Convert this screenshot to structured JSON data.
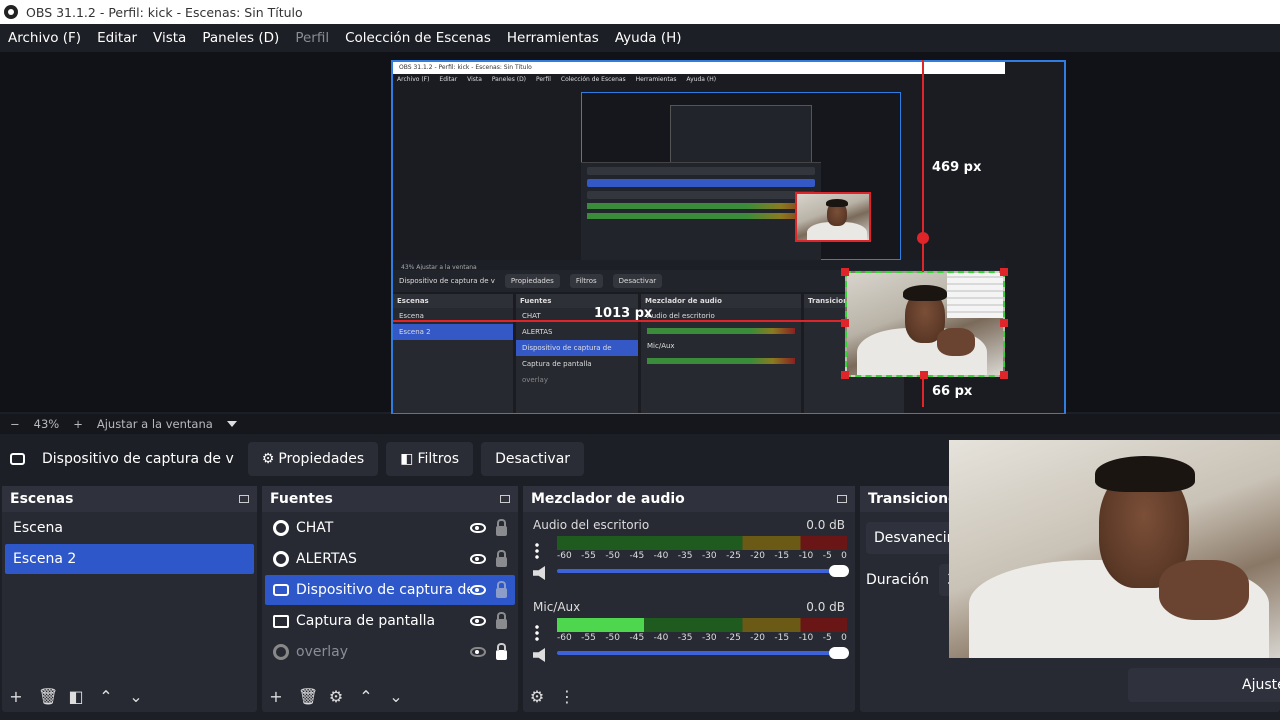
{
  "window": {
    "title": "OBS 31.1.2 - Perfil: kick - Escenas: Sin Título"
  },
  "menu": [
    {
      "label": "Archivo (F)",
      "disabled": false
    },
    {
      "label": "Editar",
      "disabled": false
    },
    {
      "label": "Vista",
      "disabled": false
    },
    {
      "label": "Paneles (D)",
      "disabled": false
    },
    {
      "label": "Perfil",
      "disabled": true
    },
    {
      "label": "Colección de Escenas",
      "disabled": false
    },
    {
      "label": "Herramientas",
      "disabled": false
    },
    {
      "label": "Ayuda (H)",
      "disabled": false
    }
  ],
  "preview": {
    "mini_title": "OBS 31.1.2 - Perfil: kick - Escenas: Sin Título",
    "mini_menu": [
      "Archivo (F)",
      "Editar",
      "Vista",
      "Paneles (D)",
      "Perfil",
      "Colección de Escenas",
      "Herramientas",
      "Ayuda (H)"
    ],
    "mini_zoom": "43%   Ajustar a la ventana",
    "mini_source": "Dispositivo de captura de v",
    "mini_props": "Propiedades",
    "mini_filters": "Filtros",
    "mini_deactivate": "Desactivar",
    "mini_scenes_head": "Escenas",
    "mini_scenes": [
      "Escena",
      "Escena 2"
    ],
    "mini_sources_head": "Fuentes",
    "mini_sources": [
      "CHAT",
      "ALERTAS",
      "Dispositivo de captura de",
      "Captura de pantalla",
      "overlay"
    ],
    "mini_mixer_head": "Mezclador de audio",
    "mini_mixer_ch1": "Audio del escritorio",
    "mini_mixer_ch2": "Mic/Aux",
    "mini_trans_head": "Transicione",
    "measure_top": "469 px",
    "measure_left": "1013 px",
    "measure_bottom": "66 px"
  },
  "zoom": {
    "minus": "−",
    "value": "43%",
    "plus": "+",
    "fit": "Ajustar a la ventana"
  },
  "source_toolbar": {
    "source_name": "Dispositivo de captura de v",
    "properties": "Propiedades",
    "filters": "Filtros",
    "deactivate": "Desactivar"
  },
  "scenes": {
    "title": "Escenas",
    "items": [
      {
        "label": "Escena",
        "selected": false
      },
      {
        "label": "Escena 2",
        "selected": true
      }
    ]
  },
  "sources": {
    "title": "Fuentes",
    "items": [
      {
        "label": "CHAT",
        "selected": false,
        "hidden": false
      },
      {
        "label": "ALERTAS",
        "selected": false,
        "hidden": false
      },
      {
        "label": "Dispositivo de captura de v",
        "selected": true,
        "hidden": false
      },
      {
        "label": "Captura de pantalla",
        "selected": false,
        "hidden": false
      },
      {
        "label": "overlay",
        "selected": false,
        "hidden": true
      }
    ]
  },
  "mixer": {
    "title": "Mezclador de audio",
    "scale": [
      "-60",
      "-55",
      "-50",
      "-45",
      "-40",
      "-35",
      "-30",
      "-25",
      "-20",
      "-15",
      "-10",
      "-5",
      "0"
    ],
    "channels": [
      {
        "name": "Audio del escritorio",
        "db": "0.0 dB",
        "level": 0
      },
      {
        "name": "Mic/Aux",
        "db": "0.0 dB",
        "level": 0.3
      }
    ]
  },
  "transitions": {
    "title": "Transiciones",
    "selected": "Desvanecim",
    "duration_label": "Duración",
    "duration_value": "30",
    "bottom_button": "Ajuste"
  },
  "colors": {
    "accent": "#2e58c9",
    "preview_border": "#2f7de1",
    "guide": "#e0252a",
    "selection": "#37d637"
  }
}
